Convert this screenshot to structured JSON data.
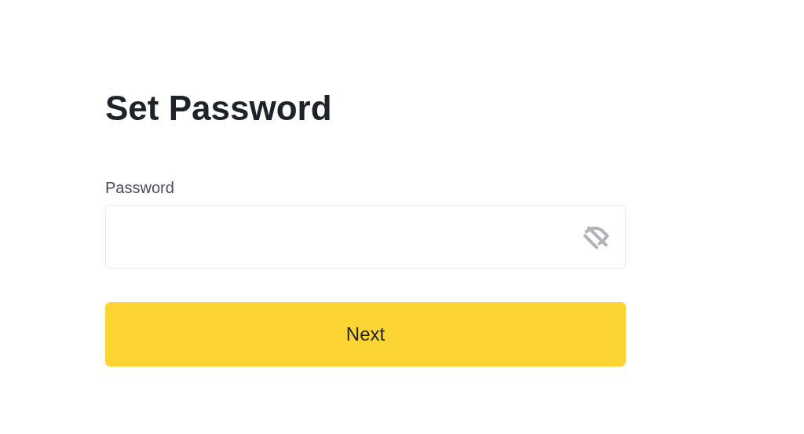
{
  "title": "Set Password",
  "password_field": {
    "label": "Password",
    "visible": false
  },
  "next_button": {
    "label": "Next"
  }
}
